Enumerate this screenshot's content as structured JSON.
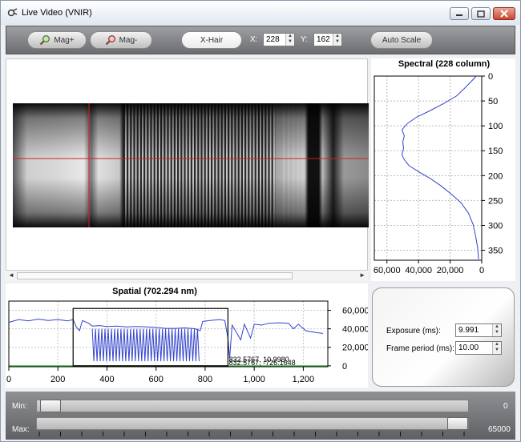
{
  "window": {
    "title": "Live Video (VNIR)"
  },
  "toolbar": {
    "mag_plus_label": "Mag+",
    "mag_minus_label": "Mag-",
    "xhair_label": "X-Hair",
    "x_label": "X:",
    "x_value": "228",
    "y_label": "Y:",
    "y_value": "162",
    "autoscale_label": "Auto Scale"
  },
  "spectral_chart": {
    "title": "Spectral (228 column)",
    "x_ticks": [
      "60,000",
      "40,000",
      "20,000",
      "0"
    ],
    "y_ticks": [
      "0",
      "50",
      "100",
      "150",
      "200",
      "250",
      "300",
      "350"
    ]
  },
  "spatial_chart": {
    "title": "Spatial (702.294 nm)",
    "x_ticks": [
      "0",
      "200",
      "400",
      "600",
      "800",
      "1,000",
      "1,200"
    ],
    "y_ticks": [
      "60,000",
      "40,000",
      "20,000",
      "0"
    ],
    "annotation_1": "832.5767, 10.9980",
    "annotation_2": "832.5767, -726.1648"
  },
  "chart_data": [
    {
      "type": "line",
      "title": "Spectral (228 column)",
      "orientation": "x-reversed, y-down",
      "xlim": [
        0,
        68000
      ],
      "ylim": [
        0,
        370
      ],
      "x_ticks": [
        60000,
        40000,
        20000,
        0
      ],
      "y_ticks": [
        0,
        50,
        100,
        150,
        200,
        250,
        300,
        350
      ],
      "series": [
        {
          "color": "#3344cc",
          "points": [
            [
              3500,
              0
            ],
            [
              7000,
              12
            ],
            [
              11000,
              25
            ],
            [
              16000,
              40
            ],
            [
              24000,
              55
            ],
            [
              33000,
              70
            ],
            [
              41000,
              82
            ],
            [
              47000,
              95
            ],
            [
              50500,
              108
            ],
            [
              49000,
              120
            ],
            [
              50000,
              132
            ],
            [
              49500,
              145
            ],
            [
              50500,
              158
            ],
            [
              49000,
              168
            ],
            [
              46000,
              180
            ],
            [
              40000,
              192
            ],
            [
              33000,
              205
            ],
            [
              26000,
              220
            ],
            [
              19000,
              238
            ],
            [
              13000,
              255
            ],
            [
              8500,
              275
            ],
            [
              5500,
              298
            ],
            [
              3800,
              322
            ],
            [
              2600,
              345
            ],
            [
              2000,
              368
            ]
          ]
        }
      ]
    },
    {
      "type": "line",
      "title": "Spatial (702.294 nm)",
      "xlim": [
        0,
        1300
      ],
      "ylim": [
        -1000,
        70000
      ],
      "x_ticks": [
        0,
        200,
        400,
        600,
        800,
        1000,
        1200
      ],
      "y_ticks": [
        0,
        20000,
        40000,
        60000
      ],
      "series": [
        {
          "color": "#3344cc",
          "points": [
            [
              0,
              47000
            ],
            [
              40,
              50000
            ],
            [
              80,
              48500
            ],
            [
              120,
              50500
            ],
            [
              160,
              49000
            ],
            [
              200,
              50000
            ],
            [
              240,
              48500
            ],
            [
              262,
              50000
            ],
            [
              275,
              42000
            ],
            [
              288,
              38000
            ],
            [
              300,
              49000
            ],
            [
              325,
              46000
            ],
            [
              340,
              43000
            ],
            [
              370,
              43500
            ],
            [
              400,
              42500
            ],
            [
              440,
              43000
            ],
            [
              480,
              42000
            ],
            [
              520,
              42500
            ],
            [
              560,
              42000
            ],
            [
              600,
              41500
            ],
            [
              640,
              40500
            ],
            [
              680,
              40500
            ],
            [
              720,
              41000
            ],
            [
              760,
              40000
            ],
            [
              780,
              38000
            ],
            [
              790,
              48000
            ],
            [
              820,
              49000
            ],
            [
              860,
              50000
            ],
            [
              880,
              49000
            ],
            [
              893,
              30000
            ],
            [
              900,
              8000
            ],
            [
              910,
              44000
            ],
            [
              930,
              35000
            ],
            [
              945,
              28000
            ],
            [
              960,
              45000
            ],
            [
              985,
              30000
            ],
            [
              1000,
              45000
            ],
            [
              1030,
              44000
            ],
            [
              1060,
              46000
            ],
            [
              1100,
              46500
            ],
            [
              1140,
              46000
            ],
            [
              1160,
              40000
            ],
            [
              1180,
              45000
            ],
            [
              1210,
              38000
            ],
            [
              1250,
              36000
            ],
            [
              1280,
              35000
            ]
          ]
        },
        {
          "color": "#3344cc",
          "name": "",
          "oscillation_region": [
            340,
            780
          ],
          "oscillation_range": [
            5000,
            40000
          ]
        }
      ]
    }
  ],
  "exposure": {
    "exposure_label": "Exposure (ms):",
    "exposure_value": "9.991",
    "frame_period_label": "Frame period  (ms):",
    "frame_period_value": "10.00"
  },
  "sliders": {
    "min_label": "Min:",
    "min_value": "0",
    "max_label": "Max:",
    "max_value": "65000"
  }
}
